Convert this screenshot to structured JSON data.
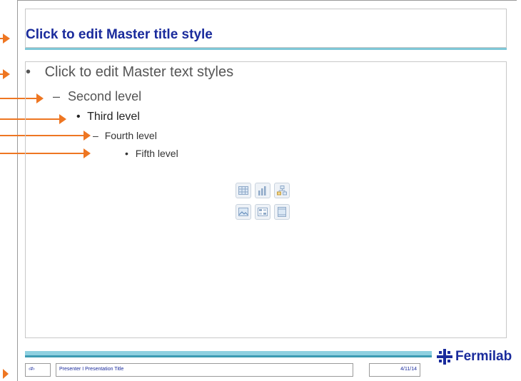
{
  "slide": {
    "title": "Click to edit Master title style",
    "levels": [
      {
        "marker": "•",
        "text": "Click to edit Master text styles"
      },
      {
        "marker": "–",
        "text": "Second level"
      },
      {
        "marker": "•",
        "text": "Third level"
      },
      {
        "marker": "–",
        "text": "Fourth level"
      },
      {
        "marker": "•",
        "text": "Fifth level"
      }
    ],
    "content_icons": [
      "insert-table-icon",
      "insert-chart-icon",
      "insert-smartart-icon",
      "insert-picture-icon",
      "insert-clipart-icon",
      "insert-media-icon"
    ]
  },
  "footer": {
    "slide_number": "‹#›",
    "presenter_title": "Presenter I Presentation Title",
    "date": "4/11/14",
    "logo_text": "Fermilab"
  },
  "colors": {
    "title": "#1a2b9c",
    "accent_rule": "#7fc7d7",
    "arrow": "#ee7622",
    "footer_bar_light": "#8ed0e0",
    "footer_bar_dark": "#3d9bb3"
  }
}
